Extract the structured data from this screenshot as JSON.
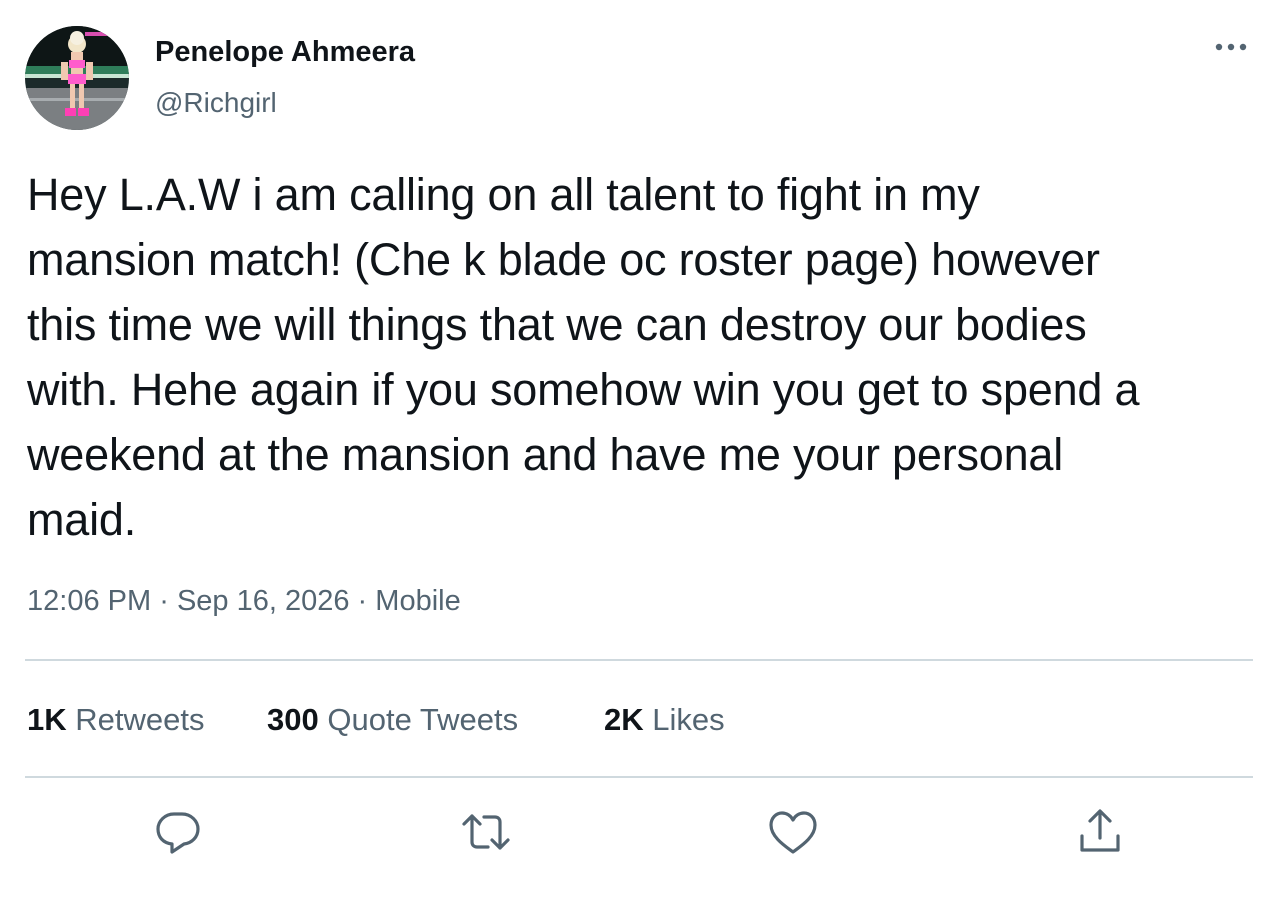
{
  "user": {
    "display_name": "Penelope Ahmeera",
    "handle": "@Richgirl"
  },
  "tweet": {
    "lines": [
      "Hey L.A.W i am calling on all talent to fight in my",
      "mansion match! (Che k blade oc roster page) however",
      "this time we will things that we can destroy our bodies",
      "with. Hehe again if you somehow win you get to spend a",
      "weekend at the mansion and have me your personal",
      "maid."
    ],
    "time": "12:06 PM",
    "date": "Sep 16, 2026",
    "source": "Mobile",
    "separator": "·"
  },
  "stats": {
    "retweets": {
      "count": "1K",
      "label": "Retweets"
    },
    "quotes": {
      "count": "300",
      "label": "Quote Tweets"
    },
    "likes": {
      "count": "2K",
      "label": "Likes"
    }
  },
  "icons": {
    "more": "more-horizontal-icon",
    "reply": "reply-icon",
    "retweet": "retweet-icon",
    "like": "heart-icon",
    "share": "share-icon"
  },
  "colors": {
    "text": "#0f1419",
    "secondary": "#536471",
    "divider": "#cfd9de"
  }
}
